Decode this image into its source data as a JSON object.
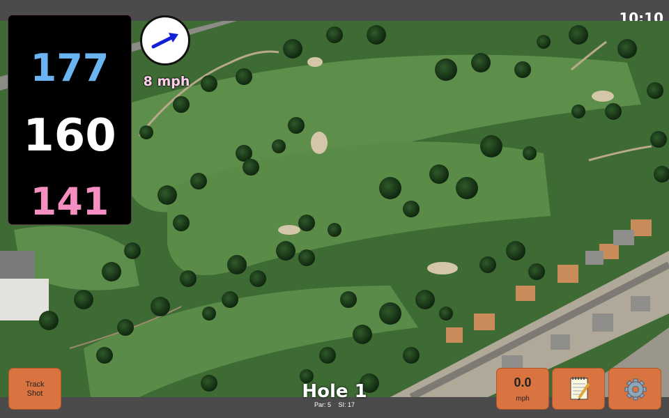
{
  "status": {
    "time": "10:10"
  },
  "distances": {
    "back": "177",
    "middle": "160",
    "front": "141"
  },
  "wind": {
    "speed": "8 mph",
    "arrow_icon": "arrow-right-icon"
  },
  "hole": {
    "title": "Hole 1",
    "par": "Par: 5",
    "stroke_index": "SI: 17"
  },
  "buttons": {
    "track_line1": "Track",
    "track_line2": "Shot",
    "speed_value": "0.0",
    "speed_unit": "mph",
    "notes_icon": "notepad-icon",
    "settings_icon": "gear-icon"
  },
  "colors": {
    "back": "#6ab4f2",
    "middle": "#ffffff",
    "front": "#f58fc2",
    "button": "#d9733f",
    "arrow": "#1020d8"
  }
}
